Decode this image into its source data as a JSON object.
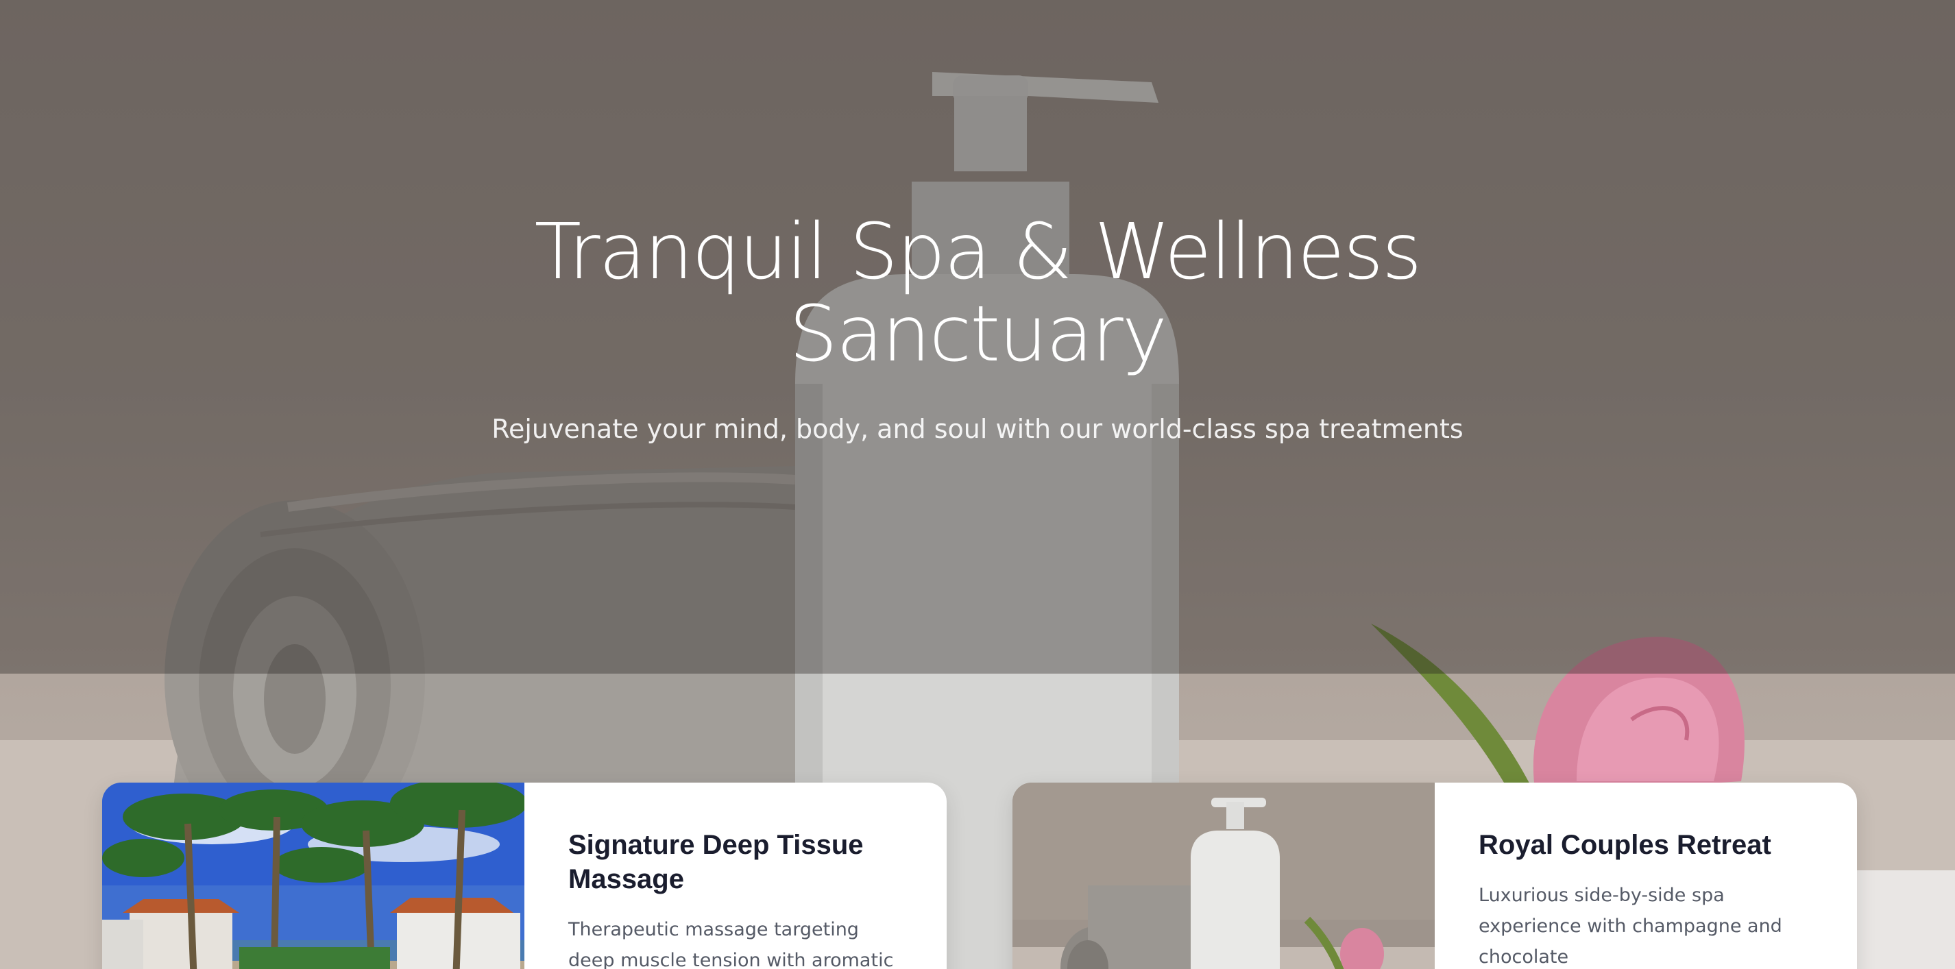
{
  "hero": {
    "title": "Tranquil Spa & Wellness Sanctuary",
    "subtitle": "Rejuvenate your mind, body, and soul with our world-class spa treatments"
  },
  "services": [
    {
      "title": "Signature Deep Tissue Massage",
      "description": "Therapeutic massage targeting deep muscle tension with aromatic oils",
      "image_icon": "tropical-resort-photo"
    },
    {
      "title": "Royal Couples Retreat",
      "description": "Luxurious side-by-side spa experience with champagne and chocolate",
      "image_icon": "spa-products-photo"
    }
  ],
  "colors": {
    "overlay": "#28221f",
    "card_bg": "#ffffff",
    "card_title": "#1a1d2e",
    "card_text": "#555a66"
  }
}
